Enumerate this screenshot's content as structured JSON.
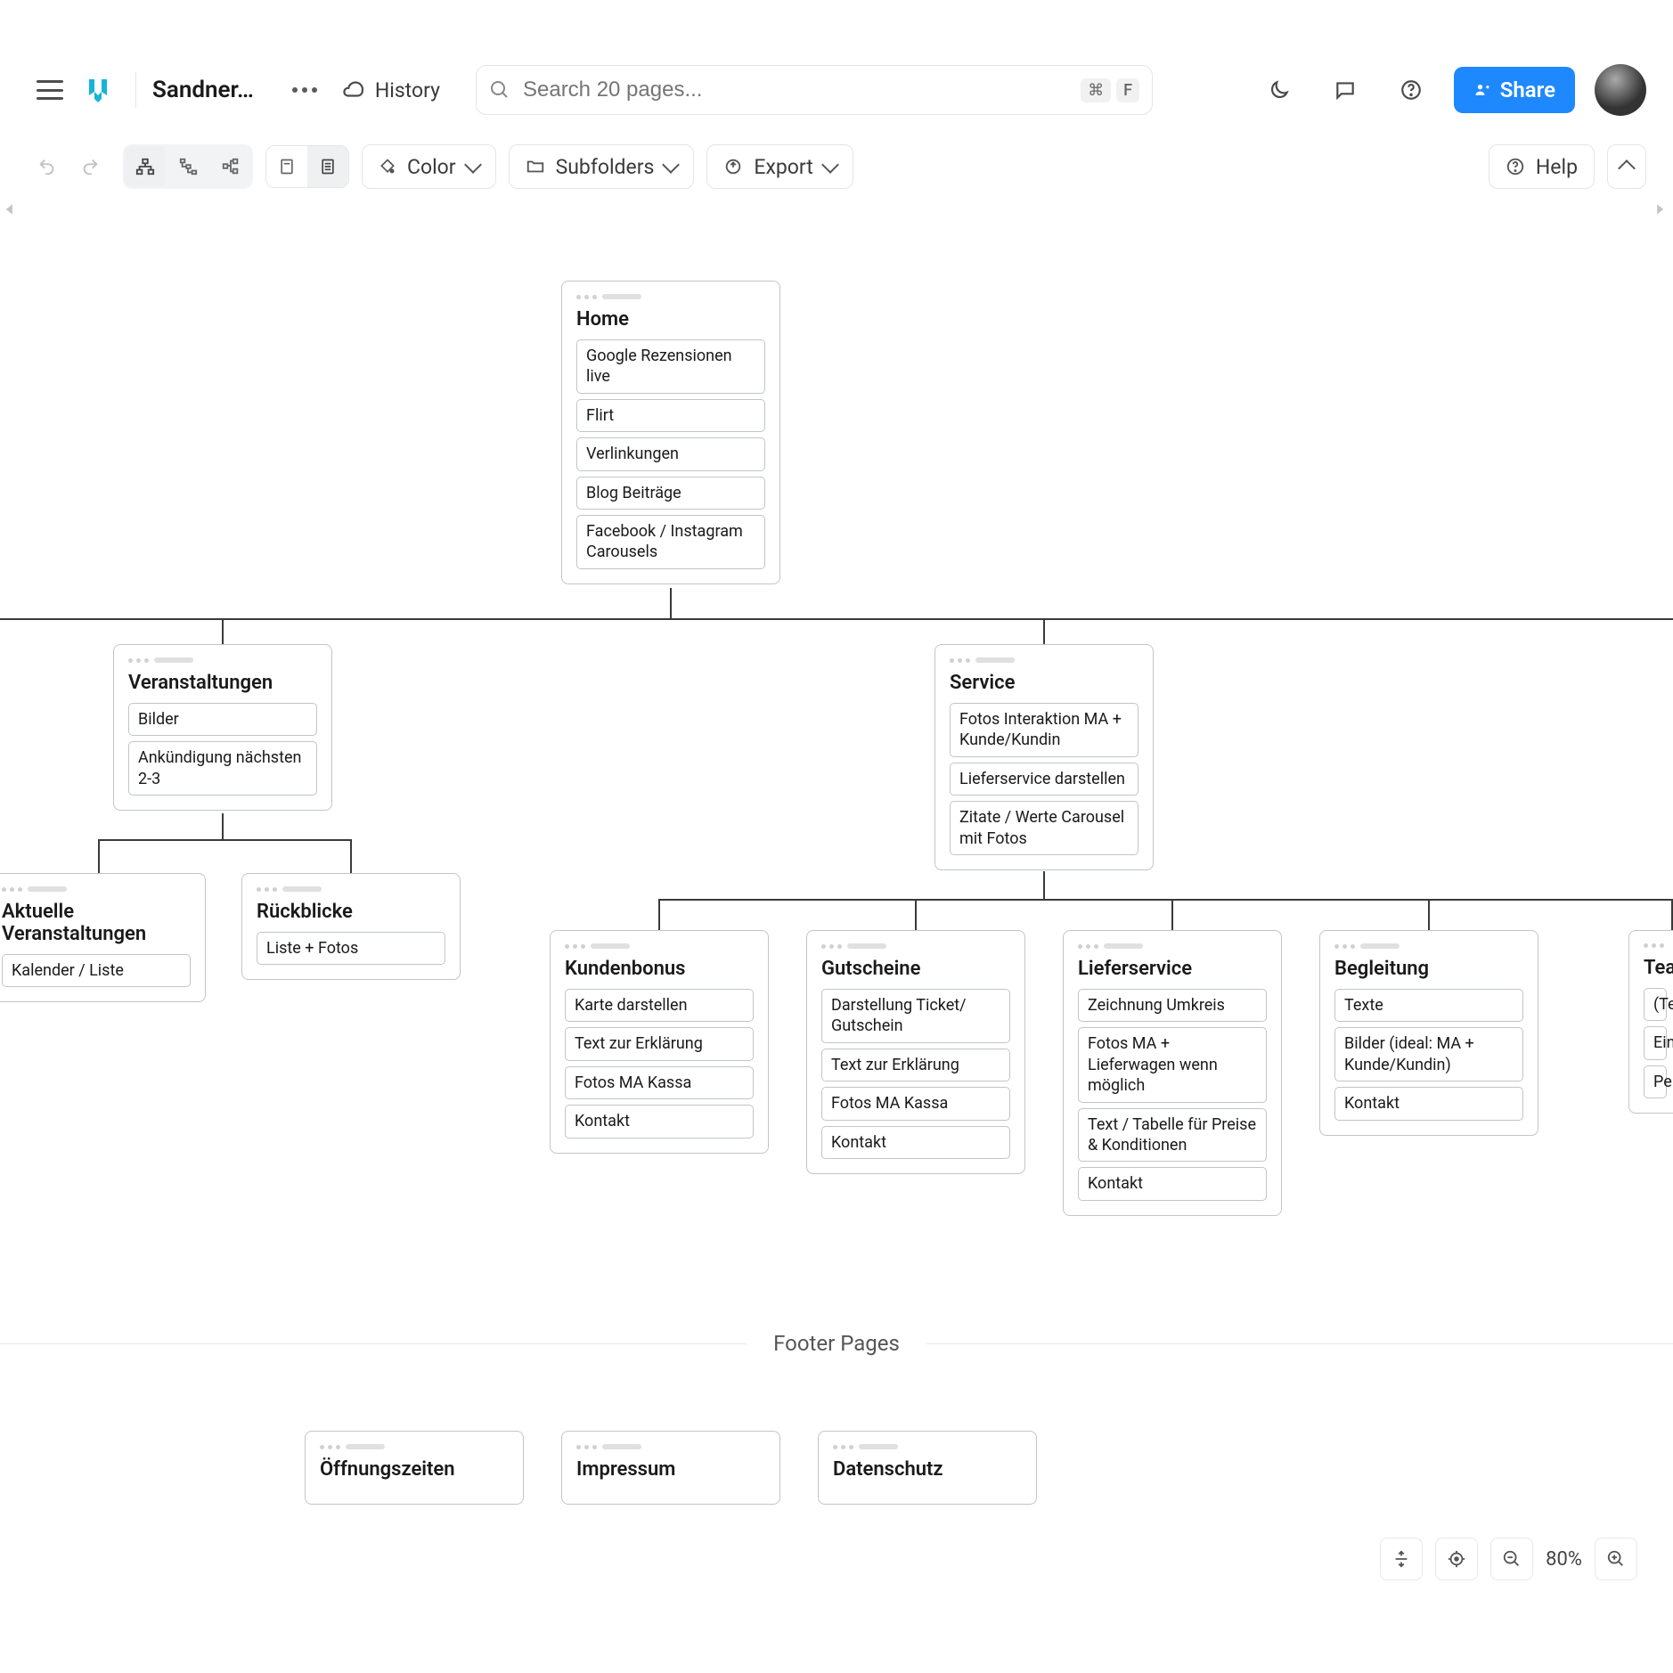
{
  "top": {
    "project_name": "Sandner…",
    "history_label": "History",
    "search_placeholder": "Search 20 pages...",
    "kbd1": "⌘",
    "kbd2": "F",
    "share_label": "Share"
  },
  "toolbar": {
    "color_label": "Color",
    "subfolders_label": "Subfolders",
    "export_label": "Export",
    "help_label": "Help"
  },
  "sitemap": {
    "home": {
      "title": "Home",
      "tags": [
        "Google Rezensionen live",
        "Flirt",
        "Verlinkungen",
        "Blog Beiträge",
        "Facebook / Instagram Carousels"
      ]
    },
    "veranstaltungen": {
      "title": "Veranstaltungen",
      "tags": [
        "Bilder",
        "Ankündigung nächsten 2-3"
      ]
    },
    "aktuelle": {
      "title": "Aktuelle Veranstaltungen",
      "tags": [
        "Kalender / Liste"
      ]
    },
    "rueckblicke": {
      "title": "Rückblicke",
      "tags": [
        "Liste + Fotos"
      ]
    },
    "service": {
      "title": "Service",
      "tags": [
        "Fotos Interaktion MA + Kunde/Kundin",
        "Lieferservice darstellen",
        "Zitate / Werte Carousel mit Fotos"
      ]
    },
    "kundenbonus": {
      "title": "Kundenbonus",
      "tags": [
        "Karte darstellen",
        "Text zur Erklärung",
        "Fotos MA Kassa",
        "Kontakt"
      ]
    },
    "gutscheine": {
      "title": "Gutscheine",
      "tags": [
        "Darstellung Ticket/ Gutschein",
        "Text zur Erklärung",
        "Fotos MA Kassa",
        "Kontakt"
      ]
    },
    "lieferservice": {
      "title": "Lieferservice",
      "tags": [
        "Zeichnung Umkreis",
        "Fotos MA + Lieferwagen wenn möglich",
        "Text / Tabelle für Preise & Konditionen",
        "Kontakt"
      ]
    },
    "begleitung": {
      "title": "Begleitung",
      "tags": [
        "Texte",
        "Bilder (ideal: MA + Kunde/Kundin)",
        "Kontakt"
      ]
    },
    "team": {
      "title": "Tea",
      "tags": [
        "(Te",
        "Ein",
        "Per"
      ]
    },
    "footer_label": "Footer Pages",
    "footer_nodes": [
      "Öffnungszeiten",
      "Impressum",
      "Datenschutz"
    ]
  },
  "zoom": {
    "level": "80%"
  }
}
